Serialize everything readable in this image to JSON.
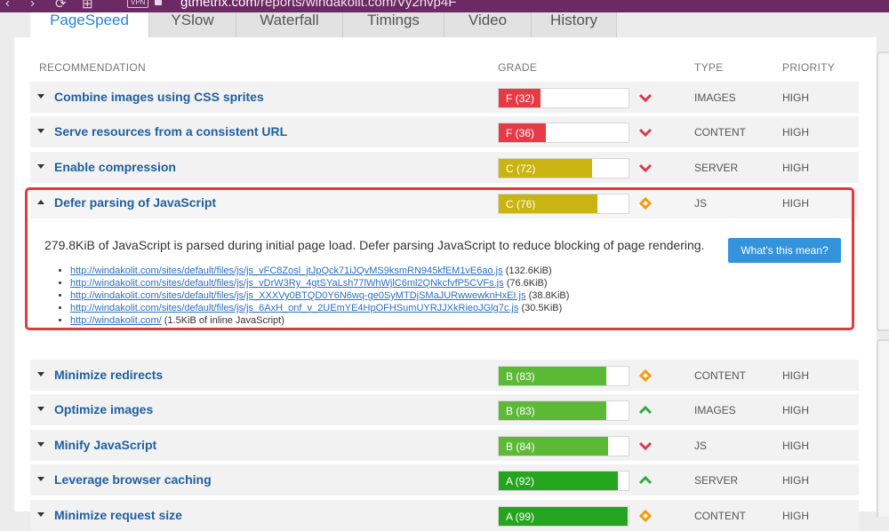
{
  "browser": {
    "nav_icons": [
      "‹",
      "›",
      "⟳",
      "⊞"
    ],
    "vpn": "VPN",
    "url_host": "gtmetrix.com",
    "url_path": "/reports/windakolit.com/Vy2hvp4F"
  },
  "tabs": [
    {
      "label": "PageSpeed",
      "active": true
    },
    {
      "label": "YSlow",
      "active": false
    },
    {
      "label": "Waterfall",
      "active": false
    },
    {
      "label": "Timings",
      "active": false
    },
    {
      "label": "Video",
      "active": false
    },
    {
      "label": "History",
      "active": false
    }
  ],
  "columns": {
    "recommendation": "RECOMMENDATION",
    "grade": "GRADE",
    "type": "TYPE",
    "priority": "PRIORITY"
  },
  "rows": [
    {
      "title": "Combine images using CSS sprites",
      "grade": "F (32)",
      "score": 32,
      "color": "#e53b46",
      "indicator": "chevron-down",
      "type": "IMAGES",
      "priority": "HIGH"
    },
    {
      "title": "Serve resources from a consistent URL",
      "grade": "F (36)",
      "score": 36,
      "color": "#e53b46",
      "indicator": "chevron-down",
      "type": "CONTENT",
      "priority": "HIGH"
    },
    {
      "title": "Enable compression",
      "grade": "C (72)",
      "score": 72,
      "color": "#c9b412",
      "indicator": "chevron-down",
      "type": "SERVER",
      "priority": "HIGH"
    },
    {
      "title": "Defer parsing of JavaScript",
      "grade": "C (76)",
      "score": 76,
      "color": "#c9b412",
      "indicator": "diamond",
      "type": "JS",
      "priority": "HIGH",
      "expanded": true
    },
    {
      "title": "Minimize redirects",
      "grade": "B (83)",
      "score": 83,
      "color": "#5cb936",
      "indicator": "diamond",
      "type": "CONTENT",
      "priority": "HIGH"
    },
    {
      "title": "Optimize images",
      "grade": "B (83)",
      "score": 83,
      "color": "#5cb936",
      "indicator": "chevron-up",
      "type": "IMAGES",
      "priority": "HIGH"
    },
    {
      "title": "Minify JavaScript",
      "grade": "B (84)",
      "score": 84,
      "color": "#5cb936",
      "indicator": "chevron-down",
      "type": "JS",
      "priority": "HIGH"
    },
    {
      "title": "Leverage browser caching",
      "grade": "A (92)",
      "score": 92,
      "color": "#25a41e",
      "indicator": "chevron-up",
      "type": "SERVER",
      "priority": "HIGH"
    },
    {
      "title": "Minimize request size",
      "grade": "A (99)",
      "score": 99,
      "color": "#25a41e",
      "indicator": "diamond",
      "type": "CONTENT",
      "priority": "HIGH"
    }
  ],
  "details": {
    "description": "279.8KiB of JavaScript is parsed during initial page load. Defer parsing JavaScript to reduce blocking of page rendering.",
    "button": "What's this mean?",
    "links": [
      {
        "url": "http://windakolit.com/sites/default/files/js/js_vFC8Zosl_jtJpQck71iJQvMS9ksmRN945kfEM1vE6ao.js",
        "note": "(132.6KiB)"
      },
      {
        "url": "http://windakolit.com/sites/default/files/js/js_vDrW3Ry_4gtSYaLsh77lWhWjlC6ml2QNkcfvfP5CVFs.js",
        "note": "(76.6KiB)"
      },
      {
        "url": "http://windakolit.com/sites/default/files/js/js_XXXVy0BTQD0Y6N6wq-ge0SyMTDjSMaJURwwewknHxEI.js",
        "note": "(38.8KiB)"
      },
      {
        "url": "http://windakolit.com/sites/default/files/js/js_6AxH_onf_v_2UEmYE4HpOFHSumUYRJJXkRieoJGlg7c.js",
        "note": "(30.5KiB)"
      },
      {
        "url": "http://windakolit.com/",
        "note": "(1.5KiB of inline JavaScript)"
      }
    ]
  }
}
